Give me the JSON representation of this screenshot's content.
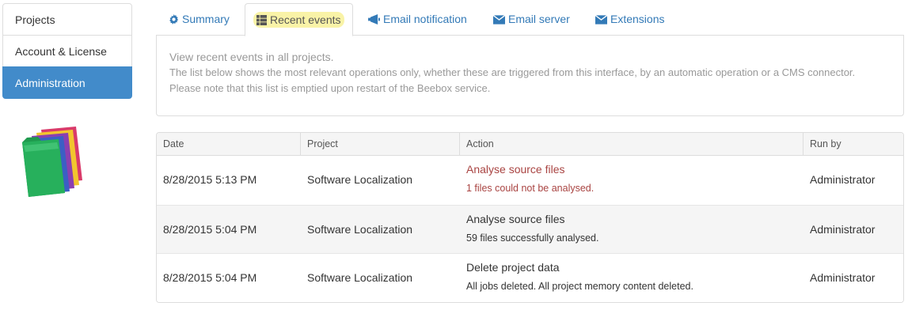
{
  "sidebar": {
    "items": [
      {
        "label": "Projects"
      },
      {
        "label": "Account & License"
      },
      {
        "label": "Administration"
      }
    ]
  },
  "tabs": [
    {
      "label": "Summary",
      "icon": "gear-icon"
    },
    {
      "label": "Recent events",
      "icon": "list-icon"
    },
    {
      "label": "Email notification",
      "icon": "megaphone-icon"
    },
    {
      "label": "Email server",
      "icon": "envelope-icon"
    },
    {
      "label": "Extensions",
      "icon": "envelope-icon"
    }
  ],
  "info": {
    "line1": "View recent events in all projects.",
    "line2": "The list below shows the most relevant operations only, whether these are triggered from this interface, by an automatic operation or a CMS connector.",
    "line3": "Please note that this list is emptied upon restart of the Beebox service."
  },
  "table": {
    "headers": [
      "Date",
      "Project",
      "Action",
      "Run by"
    ],
    "rows": [
      {
        "date": "8/28/2015 5:13 PM",
        "project": "Software Localization",
        "action": "Analyse source files",
        "detail": "1 files could not be analysed.",
        "run_by": "Administrator"
      },
      {
        "date": "8/28/2015 5:04 PM",
        "project": "Software Localization",
        "action": "Analyse source files",
        "detail": "59 files successfully analysed.",
        "run_by": "Administrator"
      },
      {
        "date": "8/28/2015 5:04 PM",
        "project": "Software Localization",
        "action": "Delete project data",
        "detail": "All jobs deleted. All project memory content deleted.",
        "run_by": "Administrator"
      }
    ]
  },
  "colors": {
    "accent": "#428bca",
    "link": "#337ab7",
    "error": "#a94442",
    "highlight": "#f9f3a7"
  }
}
